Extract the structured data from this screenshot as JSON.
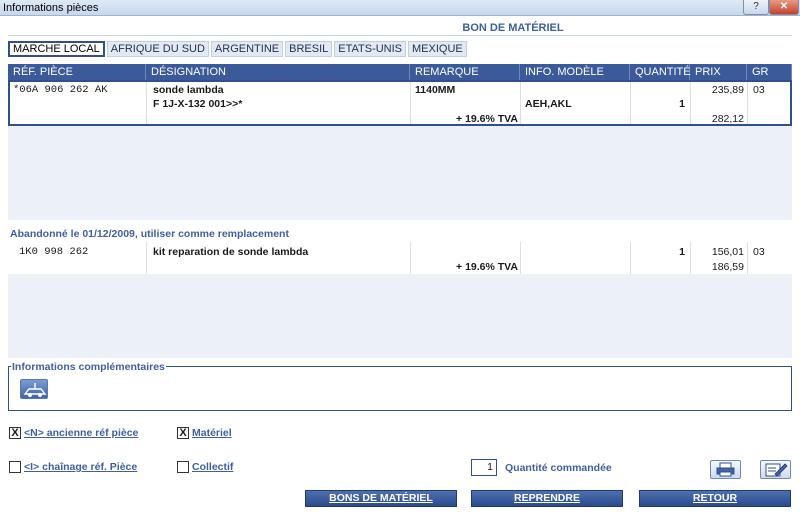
{
  "window": {
    "title": "Informations pièces",
    "help_label": "?",
    "close_label": "✕"
  },
  "sheet": {
    "title": "BON DE MATÉRIEL"
  },
  "tabs": [
    {
      "label": "MARCHE LOCAL",
      "active": true
    },
    {
      "label": "AFRIQUE DU SUD",
      "active": false
    },
    {
      "label": "ARGENTINE",
      "active": false
    },
    {
      "label": "BRESIL",
      "active": false
    },
    {
      "label": "ETATS-UNIS",
      "active": false
    },
    {
      "label": "MEXIQUE",
      "active": false
    }
  ],
  "table": {
    "headers": {
      "ref": "RÉF. PIÈCE",
      "designation": "DÉSIGNATION",
      "remarque": "REMARQUE",
      "info": "INFO. MODÈLE",
      "quantite": "QUANTITÉ",
      "prix": "PRIX",
      "gr": "GR"
    },
    "rows": [
      {
        "ref": "*06A 906 262 AK",
        "designation": "sonde lambda",
        "designation2": "F 1J-X-132 001>>*",
        "remarque": "1140MM",
        "info": "AEH,AKL",
        "quantite": "1",
        "prix": "235,89",
        "prix_ttc": "282,12",
        "gr": "03",
        "tva": "+ 19.6% TVA"
      }
    ]
  },
  "replacement": {
    "notice": "Abandonné le 01/12/2009, utiliser comme remplacement",
    "row": {
      "ref": "1K0 998 262",
      "designation": "kit reparation de sonde lambda",
      "quantite": "1",
      "prix": "156,01",
      "prix_ttc": "186,59",
      "gr": "03",
      "tva": "+ 19.6% TVA"
    }
  },
  "info_box": {
    "legend": "Informations complémentaires"
  },
  "options": {
    "ancienne_label": "<N> ancienne réf pièce",
    "ancienne_checked": "X",
    "materiel_label": "Matériel",
    "materiel_checked": "X",
    "chainage_label": "<I> chaînage réf. Pièce",
    "collectif_label": "Collectif"
  },
  "quantity": {
    "value": "1",
    "label": "Quantité commandée"
  },
  "buttons": {
    "bons": "BONS DE MATÉRIEL",
    "reprendre": "REPRENDRE",
    "retour": "RETOUR"
  },
  "colors": {
    "accent": "#3a5a9a",
    "label": "#3f5f9e",
    "panel": "#ecf1f8"
  }
}
